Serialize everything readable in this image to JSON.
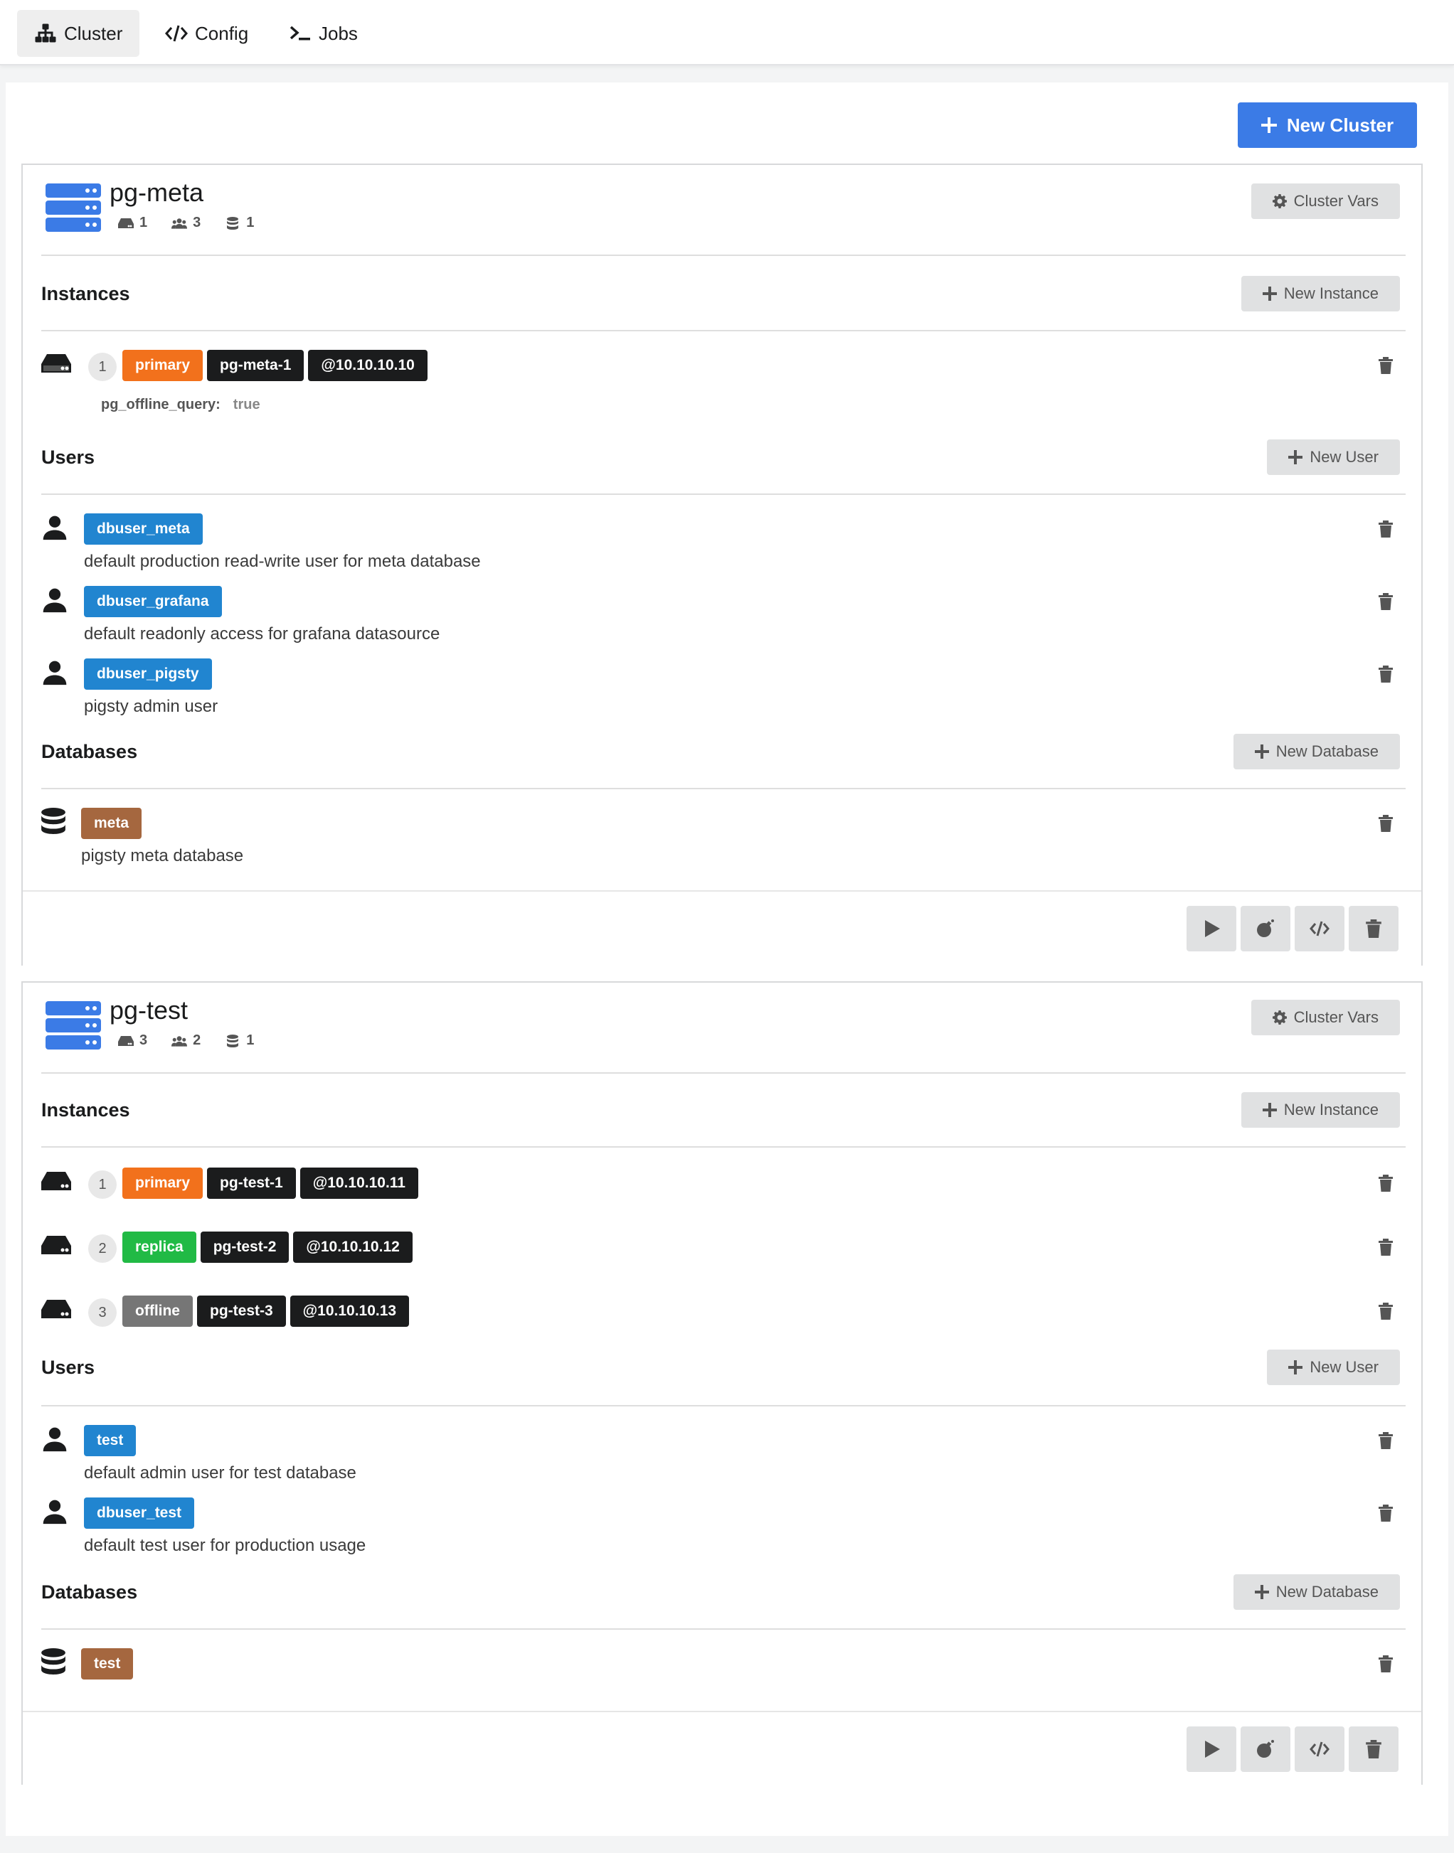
{
  "nav": {
    "items": [
      {
        "label": "Cluster",
        "icon": "sitemap-icon",
        "active": true
      },
      {
        "label": "Config",
        "icon": "code-icon",
        "active": false
      },
      {
        "label": "Jobs",
        "icon": "terminal-icon",
        "active": false
      }
    ]
  },
  "toolbar": {
    "new_cluster_label": "New Cluster"
  },
  "clusters": [
    {
      "name": "pg-meta",
      "stats": {
        "instances": "1",
        "users": "3",
        "databases": "1"
      },
      "cluster_vars_label": "Cluster Vars",
      "instances_title": "Instances",
      "new_instance_label": "New Instance",
      "instances": [
        {
          "seq": "1",
          "role": "primary",
          "name": "pg-meta-1",
          "ip": "@10.10.10.10",
          "vars": [
            {
              "key": "pg_offline_query:",
              "value": "true"
            }
          ]
        }
      ],
      "users_title": "Users",
      "new_user_label": "New User",
      "users": [
        {
          "name": "dbuser_meta",
          "desc": "default production read-write user for meta database"
        },
        {
          "name": "dbuser_grafana",
          "desc": "default readonly access for grafana datasource"
        },
        {
          "name": "dbuser_pigsty",
          "desc": "pigsty admin user"
        }
      ],
      "databases_title": "Databases",
      "new_database_label": "New Database",
      "databases": [
        {
          "name": "meta",
          "desc": "pigsty meta database"
        }
      ]
    },
    {
      "name": "pg-test",
      "stats": {
        "instances": "3",
        "users": "2",
        "databases": "1"
      },
      "cluster_vars_label": "Cluster Vars",
      "instances_title": "Instances",
      "new_instance_label": "New Instance",
      "instances": [
        {
          "seq": "1",
          "role": "primary",
          "name": "pg-test-1",
          "ip": "@10.10.10.11"
        },
        {
          "seq": "2",
          "role": "replica",
          "name": "pg-test-2",
          "ip": "@10.10.10.12"
        },
        {
          "seq": "3",
          "role": "offline",
          "name": "pg-test-3",
          "ip": "@10.10.10.13"
        }
      ],
      "users_title": "Users",
      "new_user_label": "New User",
      "users": [
        {
          "name": "test",
          "desc": "default admin user for test database"
        },
        {
          "name": "dbuser_test",
          "desc": "default test user for production usage"
        }
      ],
      "databases_title": "Databases",
      "new_database_label": "New Database",
      "databases": [
        {
          "name": "test",
          "desc": ""
        }
      ]
    }
  ],
  "colors": {
    "accent": "#3b7be6",
    "primary_role": "#f2711c",
    "replica_role": "#21ba45",
    "offline_role": "#767676",
    "user_tag": "#2185d0",
    "database_tag": "#a5673f"
  }
}
